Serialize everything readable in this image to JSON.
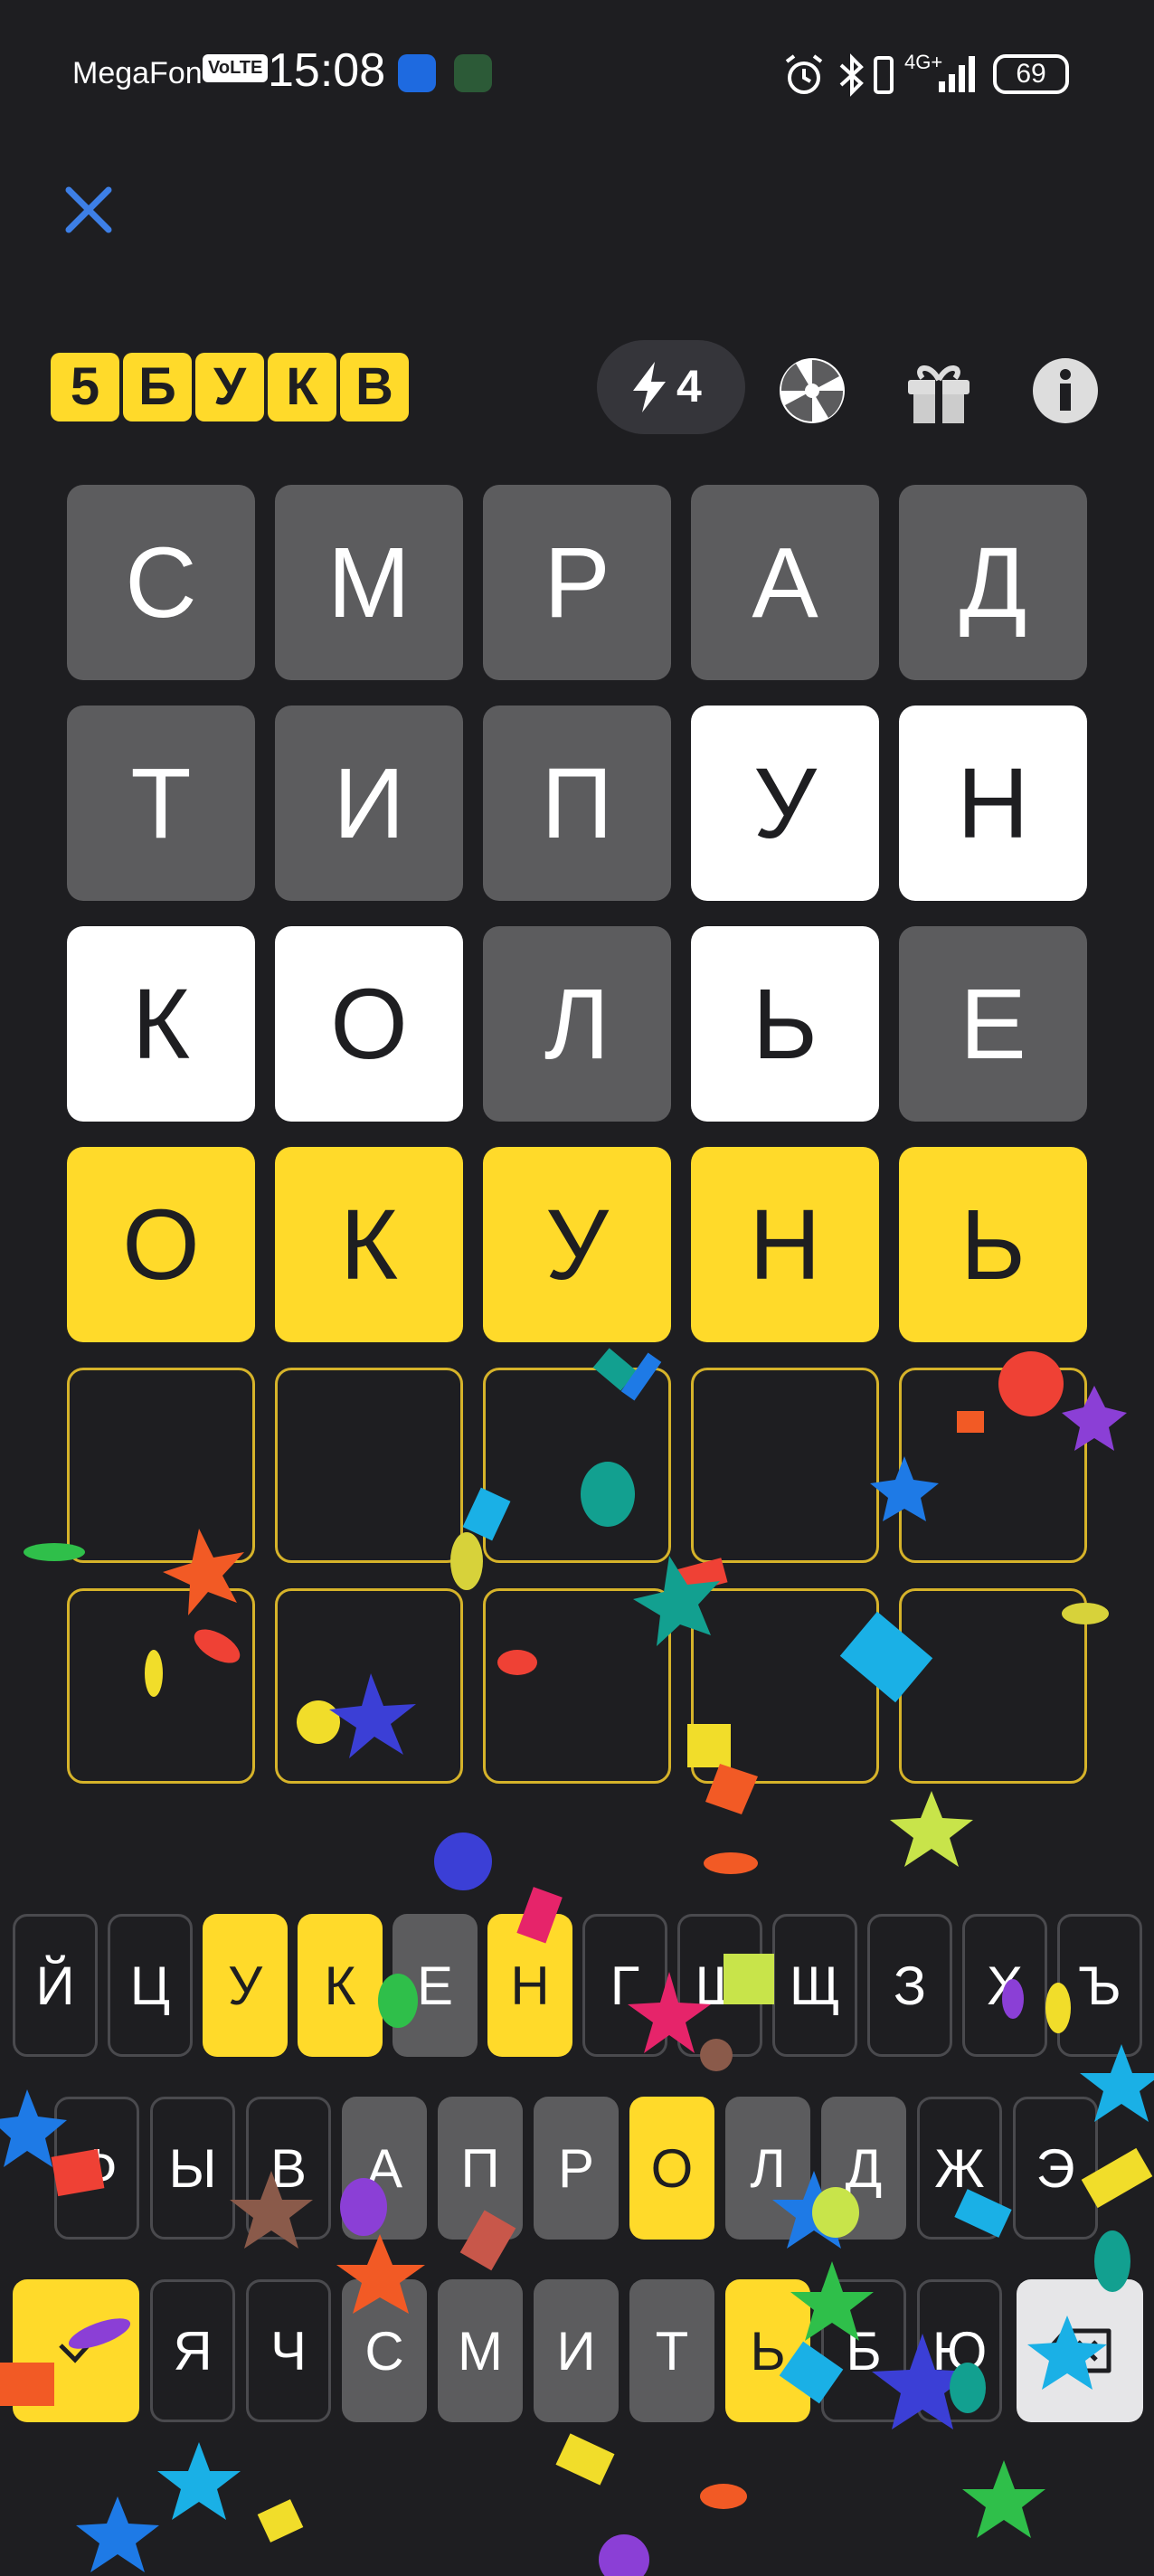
{
  "status_bar": {
    "carrier": "MegaFon",
    "volte": "VoLTE",
    "time": "15:08",
    "network": "4G+",
    "battery": "69",
    "icons": [
      "alarm-icon",
      "bluetooth-icon",
      "vibrate-icon",
      "signal-icon"
    ]
  },
  "app": {
    "logo_letters": [
      "5",
      "Б",
      "У",
      "К",
      "В"
    ],
    "energy_count": "4",
    "icons": {
      "close": "close-icon",
      "energy": "lightning-icon",
      "wheel": "wheel-icon",
      "gift": "gift-icon",
      "info": "info-icon"
    }
  },
  "board": {
    "rows": [
      {
        "letters": [
          "С",
          "М",
          "Р",
          "А",
          "Д"
        ],
        "states": [
          "absent",
          "absent",
          "absent",
          "absent",
          "absent"
        ]
      },
      {
        "letters": [
          "Т",
          "И",
          "П",
          "У",
          "Н"
        ],
        "states": [
          "absent",
          "absent",
          "absent",
          "present",
          "present"
        ]
      },
      {
        "letters": [
          "К",
          "О",
          "Л",
          "Ь",
          "Е"
        ],
        "states": [
          "present",
          "present",
          "absent",
          "present",
          "absent"
        ]
      },
      {
        "letters": [
          "О",
          "К",
          "У",
          "Н",
          "Ь"
        ],
        "states": [
          "correct",
          "correct",
          "correct",
          "correct",
          "correct"
        ]
      },
      {
        "letters": [
          "",
          "",
          "",
          "",
          ""
        ],
        "states": [
          "empty",
          "empty",
          "empty",
          "empty",
          "empty"
        ]
      },
      {
        "letters": [
          "",
          "",
          "",
          "",
          ""
        ],
        "states": [
          "empty",
          "empty",
          "empty",
          "empty",
          "empty"
        ]
      }
    ]
  },
  "keyboard": {
    "row1": [
      {
        "key": "Й",
        "state": "unused"
      },
      {
        "key": "Ц",
        "state": "unused"
      },
      {
        "key": "У",
        "state": "correct"
      },
      {
        "key": "К",
        "state": "correct"
      },
      {
        "key": "Е",
        "state": "absent"
      },
      {
        "key": "Н",
        "state": "correct"
      },
      {
        "key": "Г",
        "state": "unused"
      },
      {
        "key": "Ш",
        "state": "unused"
      },
      {
        "key": "Щ",
        "state": "unused"
      },
      {
        "key": "З",
        "state": "unused"
      },
      {
        "key": "Х",
        "state": "unused"
      },
      {
        "key": "Ъ",
        "state": "unused"
      }
    ],
    "row2": [
      {
        "key": "Ф",
        "state": "unused"
      },
      {
        "key": "Ы",
        "state": "unused"
      },
      {
        "key": "В",
        "state": "unused"
      },
      {
        "key": "А",
        "state": "absent"
      },
      {
        "key": "П",
        "state": "absent"
      },
      {
        "key": "Р",
        "state": "absent"
      },
      {
        "key": "О",
        "state": "correct"
      },
      {
        "key": "Л",
        "state": "absent"
      },
      {
        "key": "Д",
        "state": "absent"
      },
      {
        "key": "Ж",
        "state": "unused"
      },
      {
        "key": "Э",
        "state": "unused"
      }
    ],
    "row3": [
      {
        "key": "Я",
        "state": "unused"
      },
      {
        "key": "Ч",
        "state": "unused"
      },
      {
        "key": "С",
        "state": "absent"
      },
      {
        "key": "М",
        "state": "absent"
      },
      {
        "key": "И",
        "state": "absent"
      },
      {
        "key": "Т",
        "state": "absent"
      },
      {
        "key": "Ь",
        "state": "correct"
      },
      {
        "key": "Б",
        "state": "unused"
      },
      {
        "key": "Ю",
        "state": "unused"
      }
    ],
    "enter_icon": "checkmark-icon",
    "backspace_icon": "backspace-icon"
  },
  "colors": {
    "background": "#1e1e21",
    "correct": "#ffda2a",
    "present": "#ffffff",
    "absent": "#5c5c5e",
    "empty_border": "#d6b32a",
    "close_icon": "#3d7fe6"
  }
}
